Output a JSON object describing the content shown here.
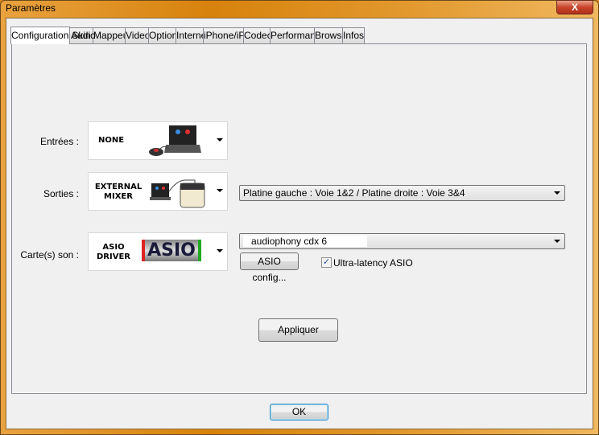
{
  "window": {
    "title": "Paramètres",
    "close_label": "X"
  },
  "tabs": [
    {
      "label": "Configuration Audio"
    },
    {
      "label": "Skin"
    },
    {
      "label": "Mappeurs"
    },
    {
      "label": "Video"
    },
    {
      "label": "Options"
    },
    {
      "label": "Internet"
    },
    {
      "label": "iPhone/iPad"
    },
    {
      "label": "Codecs"
    },
    {
      "label": "Performances"
    },
    {
      "label": "Browser"
    },
    {
      "label": "Infos"
    }
  ],
  "audio": {
    "inputs": {
      "label": "Entrées :",
      "value": "NONE"
    },
    "outputs": {
      "label": "Sorties :",
      "value_line1": "EXTERNAL",
      "value_line2": "MIXER",
      "routing": "Platine gauche : Voie 1&2 / Platine droite : Voie 3&4"
    },
    "soundcard": {
      "label": "Carte(s) son :",
      "value_line1": "ASIO",
      "value_line2": "DRIVER",
      "logo_text": "ASIO",
      "device": "audiophony cdx 6",
      "config_button": "ASIO config...",
      "ultra_latency_label": "Ultra-latency ASIO",
      "ultra_latency_checked": true
    },
    "apply_button": "Appliquer"
  },
  "ok_button": "OK"
}
